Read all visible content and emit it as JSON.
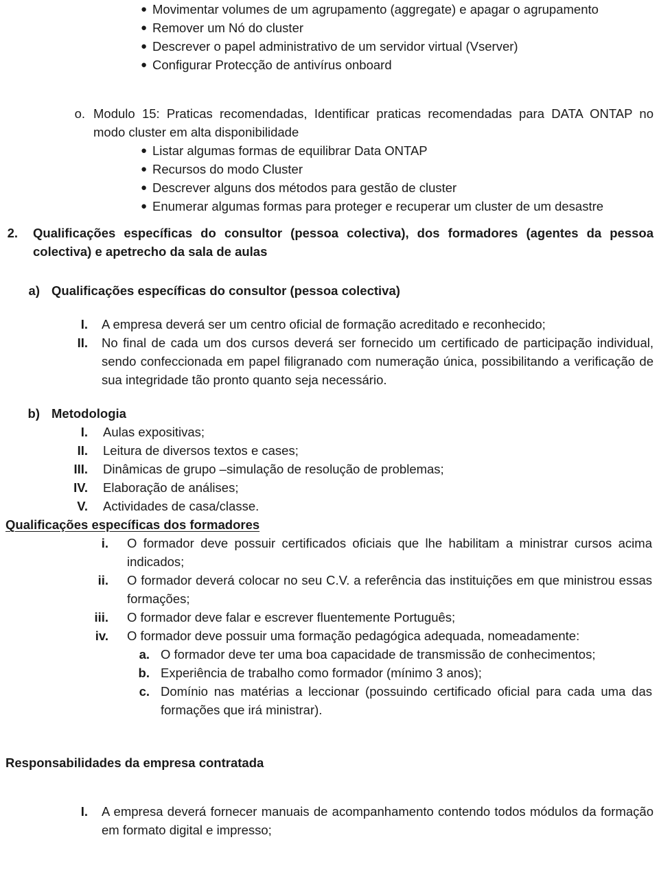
{
  "document": {
    "top_bullets": [
      "Movimentar volumes de um agrupamento (aggregate) e apagar o agrupamento",
      "Remover um Nó do cluster",
      "Descrever o papel administrativo de um servidor virtual (Vserver)",
      "Configurar Protecção de antivírus onboard"
    ],
    "module_item": {
      "marker": "o.",
      "text": "Modulo 15: Praticas recomendadas, Identificar praticas recomendadas para DATA ONTAP no modo cluster em alta disponibilidade",
      "bullets": [
        "Listar algumas formas de equilibrar Data ONTAP",
        "Recursos do modo Cluster",
        "Descrever alguns dos métodos para gestão de cluster",
        "Enumerar algumas formas para proteger e recuperar um cluster de um desastre"
      ]
    },
    "section2": {
      "marker": "2.",
      "title": "Qualificações específicas do consultor (pessoa colectiva), dos formadores (agentes da pessoa colectiva) e apetrecho da sala de aulas",
      "subsection_a": {
        "marker": "a)",
        "title": "Qualificações específicas do consultor (pessoa colectiva)",
        "items": [
          {
            "marker": "I.",
            "text": "A empresa deverá ser um centro oficial de formação acreditado e reconhecido;"
          },
          {
            "marker": "II.",
            "text": "No final de cada um dos cursos deverá ser fornecido um certificado de participação individual, sendo confeccionada em papel filigranado com numeração única, possibilitando a verificação de sua integridade tão pronto quanto seja necessário."
          }
        ]
      },
      "subsection_b": {
        "marker": "b)",
        "title": "Metodologia",
        "items": [
          {
            "marker": "I.",
            "text": "Aulas expositivas;"
          },
          {
            "marker": "II.",
            "text": "Leitura de diversos textos e cases;"
          },
          {
            "marker": "III.",
            "text": "Dinâmicas de grupo –simulação de resolução de problemas;"
          },
          {
            "marker": "IV.",
            "text": "Elaboração de análises;"
          },
          {
            "marker": "V.",
            "text": "Actividades de casa/classe."
          }
        ]
      }
    },
    "trainers_heading": "Qualificações específicas dos formadores",
    "trainers_items": [
      {
        "marker": "i.",
        "text": "O formador deve possuir certificados oficiais que lhe habilitam a ministrar cursos acima indicados;"
      },
      {
        "marker": "ii.",
        "text": "O formador deverá colocar no seu C.V. a referência das instituições em que ministrou essas formações;"
      },
      {
        "marker": "iii.",
        "text": "O formador deve falar e escrever fluentemente Português;"
      },
      {
        "marker": "iv.",
        "text": "O formador deve possuir uma formação pedagógica adequada, nomeadamente:"
      }
    ],
    "trainers_subitems": [
      {
        "marker": "a.",
        "text": "O formador deve ter uma boa capacidade de transmissão de conhecimentos;"
      },
      {
        "marker": "b.",
        "text": "Experiência de trabalho como formador (mínimo 3 anos);"
      },
      {
        "marker": "c.",
        "text": "Domínio nas matérias a leccionar (possuindo certificado oficial para cada uma das formações que irá ministrar)."
      }
    ],
    "responsibilities_heading": "Responsabilidades da empresa contratada",
    "responsibilities_items": [
      {
        "marker": "I.",
        "text": "A empresa deverá fornecer manuais de acompanhamento contendo todos módulos da formação em formato digital e impresso;"
      }
    ]
  }
}
